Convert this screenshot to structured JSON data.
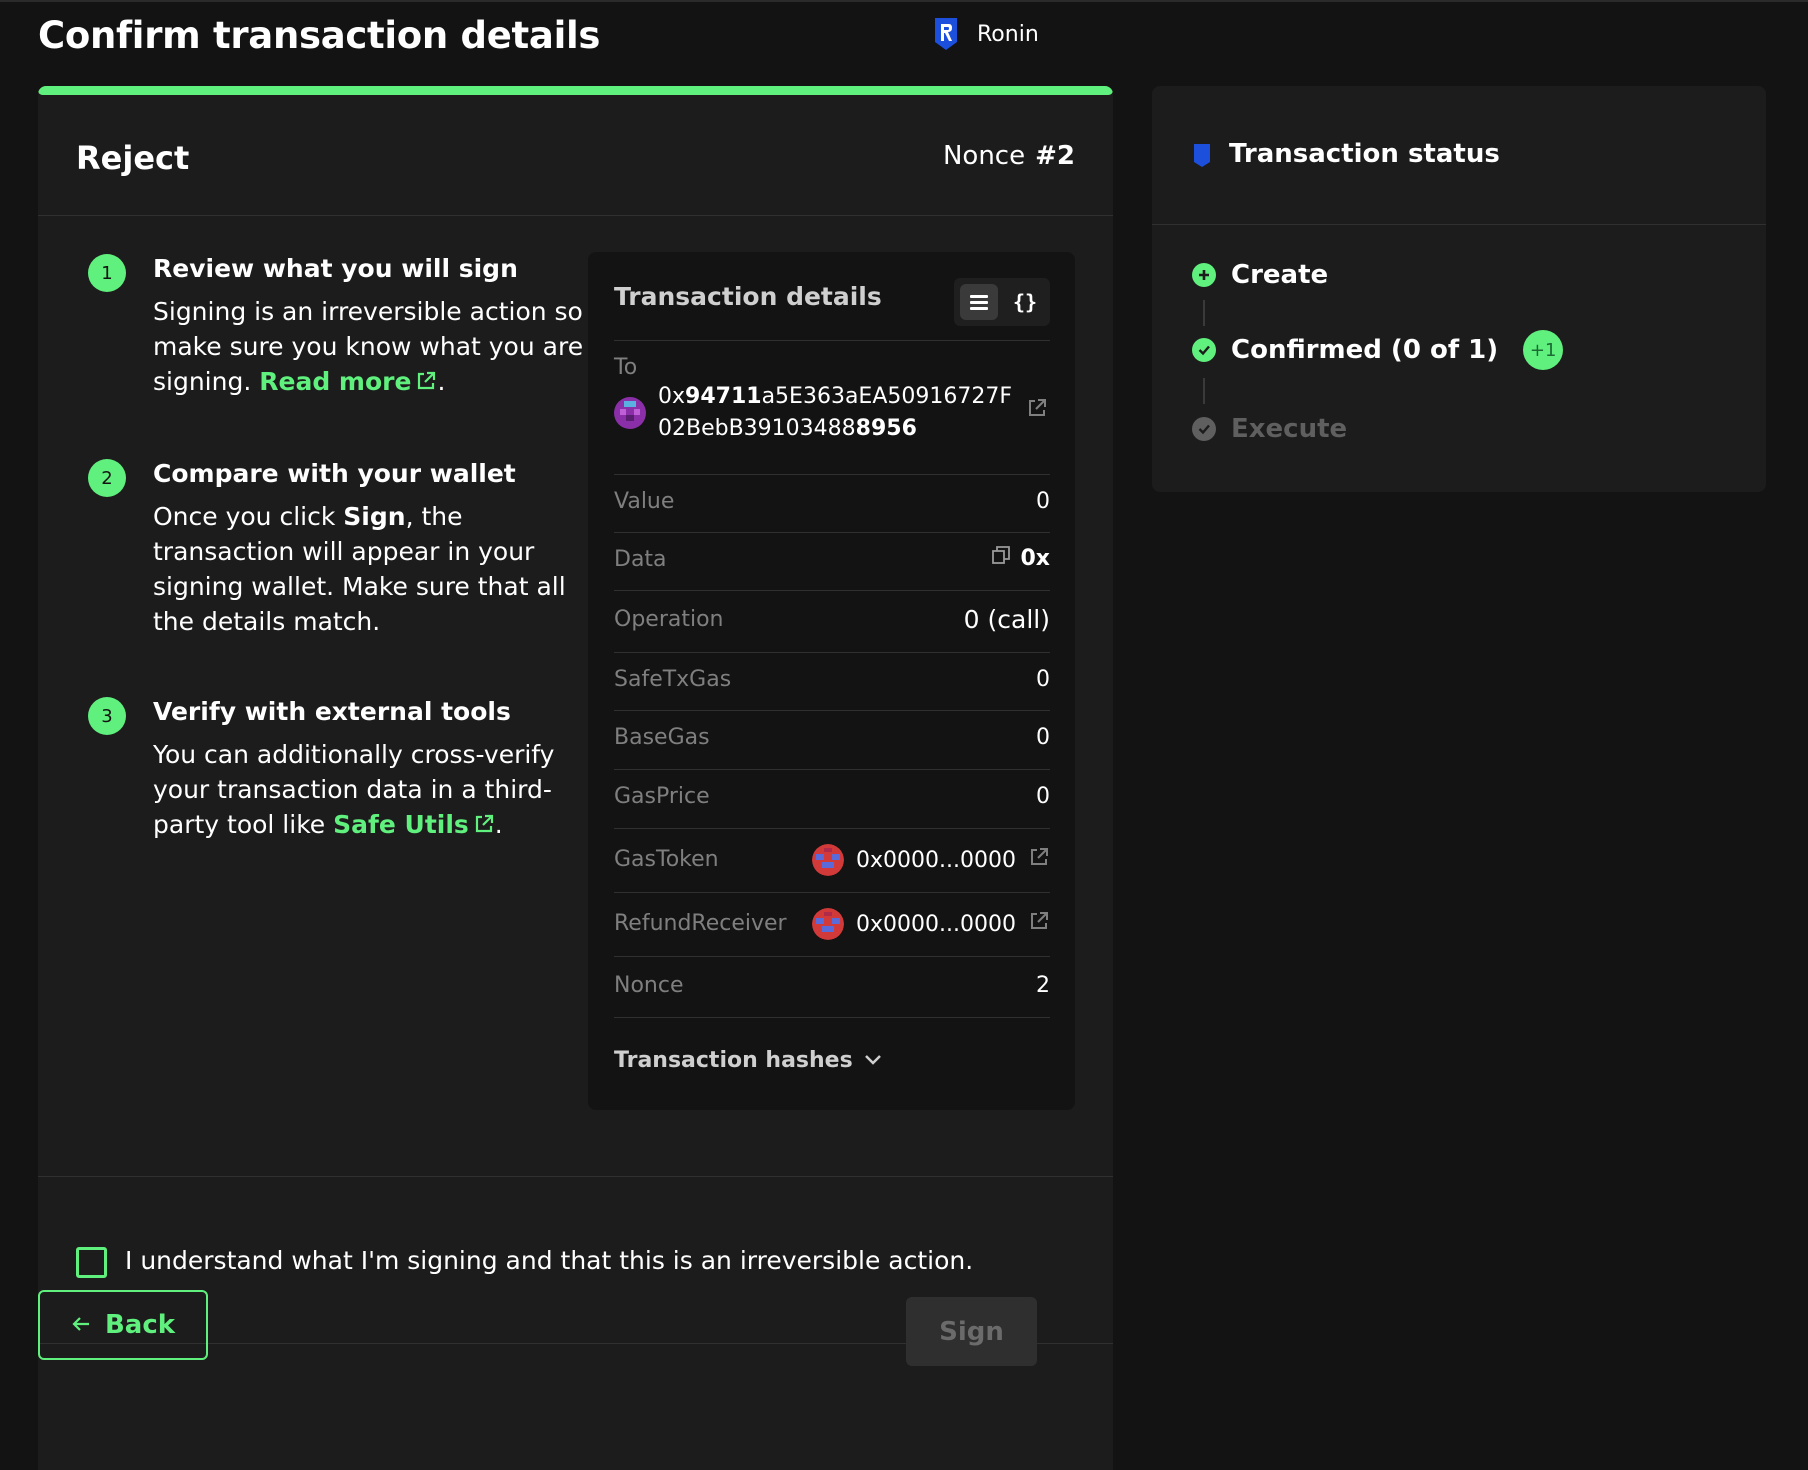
{
  "header": {
    "title": "Confirm transaction details",
    "network": "Ronin"
  },
  "card": {
    "title": "Reject",
    "nonce_label": "Nonce",
    "nonce_value": "#2"
  },
  "steps": [
    {
      "num": "1",
      "title": "Review what you will sign",
      "text": "Signing is an irreversible action so make sure you know what you are signing.",
      "link": "Read more",
      "suffix": "."
    },
    {
      "num": "2",
      "title": "Compare with your wallet",
      "text_prefix": "Once you click",
      "text_bold": "Sign",
      "text_suffix": ", the transaction will appear in your signing wallet. Make sure that all the details match."
    },
    {
      "num": "3",
      "title": "Verify with external tools",
      "text": "You can additionally cross-verify your transaction data in a third-party tool like",
      "link": "Safe Utils",
      "suffix": "."
    }
  ],
  "details": {
    "title": "Transaction details",
    "to_label": "To",
    "to_prefix": "0x",
    "to_bold1": "94711",
    "to_mid": "a5E363aEA50916727F02BebB391034",
    "to_mid2": "88",
    "to_bold2": "8956",
    "rows": [
      {
        "label": "Value",
        "value": "0"
      },
      {
        "label": "Data",
        "value": "0x"
      },
      {
        "label": "Operation",
        "value": "0 (call)"
      },
      {
        "label": "SafeTxGas",
        "value": "0"
      },
      {
        "label": "BaseGas",
        "value": "0"
      },
      {
        "label": "GasPrice",
        "value": "0"
      },
      {
        "label": "GasToken",
        "value": "0x0000...0000"
      },
      {
        "label": "RefundReceiver",
        "value": "0x0000...0000"
      },
      {
        "label": "Nonce",
        "value": "2"
      }
    ],
    "hashes_label": "Transaction hashes"
  },
  "confirm": {
    "checkbox_label": "I understand what I'm signing and that this is an irreversible action.",
    "back_label": "Back",
    "sign_label": "Sign"
  },
  "status": {
    "title": "Transaction status",
    "items": [
      {
        "label": "Create"
      },
      {
        "label": "Confirmed (0 of 1)",
        "badge": "+1"
      },
      {
        "label": "Execute"
      }
    ]
  },
  "colors": {
    "accent": "#5ff07d",
    "background": "#121312",
    "card": "#1c1c1c",
    "muted": "#7f7f7f",
    "ronin_blue": "#1c4fdc"
  }
}
